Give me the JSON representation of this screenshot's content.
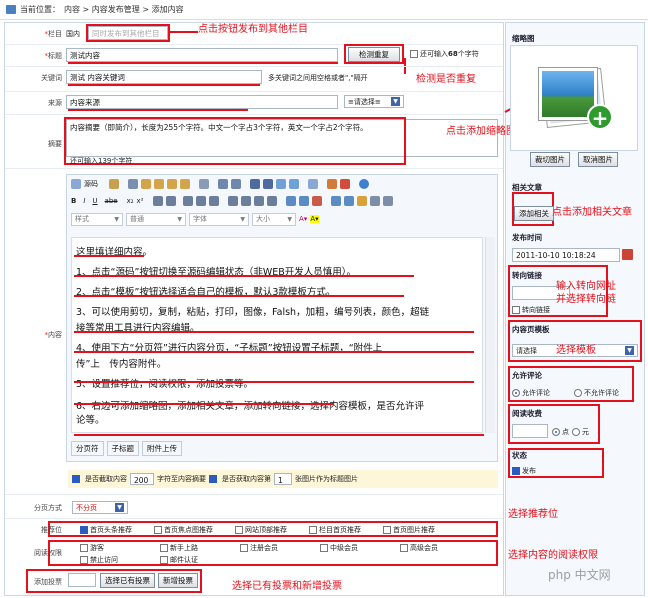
{
  "breadcrumb": {
    "prefix": "当前位置：",
    "path": "内容 > 内容发布管理 > 添加内容"
  },
  "form": {
    "column": {
      "label": "栏目",
      "value": "国内",
      "placeholder": "同时发布到其他栏目"
    },
    "title": {
      "label": "标题",
      "value": "测试内容",
      "check_btn": "检测重复",
      "counter_pre": "还可输入",
      "counter_num": "68",
      "counter_post": "个字符"
    },
    "keywords": {
      "label": "关键词",
      "value": "测试 内容关键词",
      "hint": "多关键词之间用空格或者\",\"隔开"
    },
    "source": {
      "label": "来源",
      "value": "内容来源",
      "select": "≡请选择≡"
    },
    "summary": {
      "label": "摘要",
      "text": "内容摘要（即简介），长度为255个字符。中文一个字占3个字符，英文一个字占2个字符。",
      "counter": "还可输入139个字符"
    },
    "content": {
      "label": "内容"
    },
    "pagination": {
      "label": "分页方式",
      "value": "不分页"
    },
    "recommend": {
      "label": "推荐位",
      "options": [
        "首页头条推荐",
        "首页焦点图推荐",
        "网站顶部推荐",
        "栏目首页推荐",
        "首页图片推荐"
      ]
    },
    "permission": {
      "label": "阅读权限",
      "options": [
        "游客",
        "新手上路",
        "注册会员",
        "中级会员",
        "高级会员",
        "禁止访问",
        "邮件认证"
      ]
    },
    "vote": {
      "label": "添加投票",
      "btn1": "选择已有投票",
      "btn2": "新增投票"
    }
  },
  "editor": {
    "tb1": [
      "源码"
    ],
    "style_sel": "样式",
    "format_sel": "普通",
    "font_sel": "字体",
    "size_sel": "大小",
    "lines": [
      "这里填详细内容。",
      "1、点击“源码”按钮切换至源码编辑状态（非WEB开发人员慎用）。",
      "2、点击“模板”按钮选择适合自己的模板，默认3款模板方式。",
      "3、可以使用剪切，复制，粘贴，打印，图像，Falsh，加粗，编号列表，颜色，超链",
      "接等常用工具进行内容编辑。",
      "4、使用下方“分页符”进行内容分页，“子标题”按钮设置子标题，“附件上",
      "传”上　传内容附件。",
      "5、设置推荐位，阅读权限，添加投票等。",
      "6、右边可添加缩略图，添加相关文章，添加转向链接，选择内容模板，是否允许评",
      "论等。"
    ],
    "bottom_btns": [
      "分页符",
      "子标题",
      "附件上传"
    ],
    "extract": {
      "label1": "是否截取内容",
      "num1": "200",
      "label2": "字符至内容摘要",
      "label3": "是否获取内容第",
      "num2": "1",
      "label4": "张图片作为标题图片"
    }
  },
  "sidebar": {
    "thumb": {
      "title": "缩略图",
      "crop": "裁切图片",
      "cancel": "取消图片"
    },
    "related": {
      "title": "相关文章",
      "btn": "添加相关"
    },
    "time": {
      "title": "发布时间",
      "value": "2011-10-10 10:18:24"
    },
    "redirect": {
      "title": "转向链接",
      "checkbox": "转向链接"
    },
    "template": {
      "title": "内容页模板",
      "value": "请选择"
    },
    "comment": {
      "title": "允许评论",
      "yes": "允许评论",
      "no": "不允许评论"
    },
    "read": {
      "title": "阅读收费",
      "yes": "点",
      "no": "元"
    },
    "status": {
      "title": "状态",
      "value": "发布"
    }
  },
  "annotations": {
    "a1": "点击按钮发布到其他栏目",
    "a2": "检测是否重复",
    "a3": "点击添加缩略图",
    "a4": "点击添加相关文章",
    "a5": "输入转向网址",
    "a6": "并选择转向链",
    "a7": "选择模板",
    "a8": "选择推荐位",
    "a9": "选择内容的阅读权限",
    "a10": "选择已有投票和新增投票"
  },
  "watermark": "php 中文网",
  "colors": {
    "annotation": "#e4101b",
    "accent": "#2a5cbf"
  }
}
